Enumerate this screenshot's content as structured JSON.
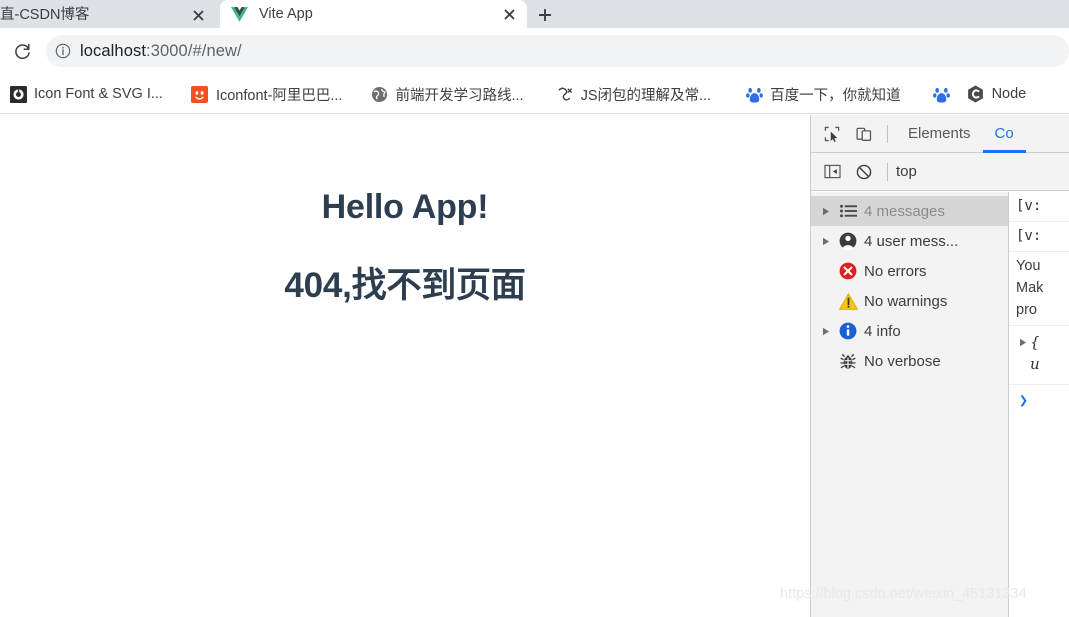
{
  "browser": {
    "tabs": [
      {
        "title": "直-CSDN博客",
        "favicon": "none-icon",
        "active": false,
        "close_label": "×"
      },
      {
        "title": "Vite App",
        "favicon": "vue-logo-icon",
        "active": true,
        "close_label": "×"
      }
    ],
    "new_tab_label": "+",
    "reload_icon": "reload-icon",
    "info_icon": "page-info-icon",
    "url": {
      "full": "localhost:3000/#/new/",
      "host": "localhost",
      "path": ":3000/#/new/"
    },
    "bookmarks": [
      {
        "label": "Icon Font & SVG I...",
        "icon": "iconfont-black-icon"
      },
      {
        "label": "Iconfont-阿里巴巴...",
        "icon": "iconfont-orange-icon"
      },
      {
        "label": "前端开发学习路线...",
        "icon": "globe-icon"
      },
      {
        "label": "JS闭包的理解及常...",
        "icon": "js-closure-icon"
      },
      {
        "label": "百度一下，你就知道",
        "icon": "baidu-icon"
      },
      {
        "label": "",
        "icon": "baidu-icon"
      },
      {
        "label": "Node",
        "icon": "nodejs-icon"
      }
    ]
  },
  "page": {
    "heading": "Hello App!",
    "subheading": "404,找不到页面",
    "text_color": "#2c3e50"
  },
  "devtools": {
    "inspect_icon": "inspect-element-icon",
    "device_icon": "device-toolbar-icon",
    "tabs": [
      {
        "label": "Elements",
        "active": false
      },
      {
        "label": "Co",
        "active": true
      }
    ],
    "sidebar_toggle_icon": "show-console-sidebar-icon",
    "clear_icon": "clear-console-icon",
    "context": "top",
    "filters": [
      {
        "label": "4 messages",
        "icon": "list-icon",
        "arrow": true,
        "selected": true,
        "muted": false
      },
      {
        "label": "4 user mess...",
        "icon": "user-icon",
        "arrow": true,
        "selected": false,
        "muted": false
      },
      {
        "label": "No errors",
        "icon": "error-icon",
        "arrow": false,
        "selected": false,
        "muted": false
      },
      {
        "label": "No warnings",
        "icon": "warning-icon",
        "arrow": false,
        "selected": false,
        "muted": false
      },
      {
        "label": "4 info",
        "icon": "info-icon",
        "arrow": true,
        "selected": false,
        "muted": false
      },
      {
        "label": "No verbose",
        "icon": "bug-icon",
        "arrow": false,
        "selected": false,
        "muted": false
      }
    ],
    "console_lines": [
      {
        "kind": "mono",
        "text": "[v:"
      },
      {
        "kind": "mono",
        "text": "[v:"
      },
      {
        "kind": "plain",
        "text": "You\nMak\npro"
      }
    ],
    "console_object": {
      "arrow": "▶",
      "line1": "{",
      "line2": "u"
    },
    "prompt_symbol": "❯",
    "accent_color": "#1a73e8"
  },
  "watermark": {
    "text": "https://blog.csdn.net/weixin_45131334"
  }
}
